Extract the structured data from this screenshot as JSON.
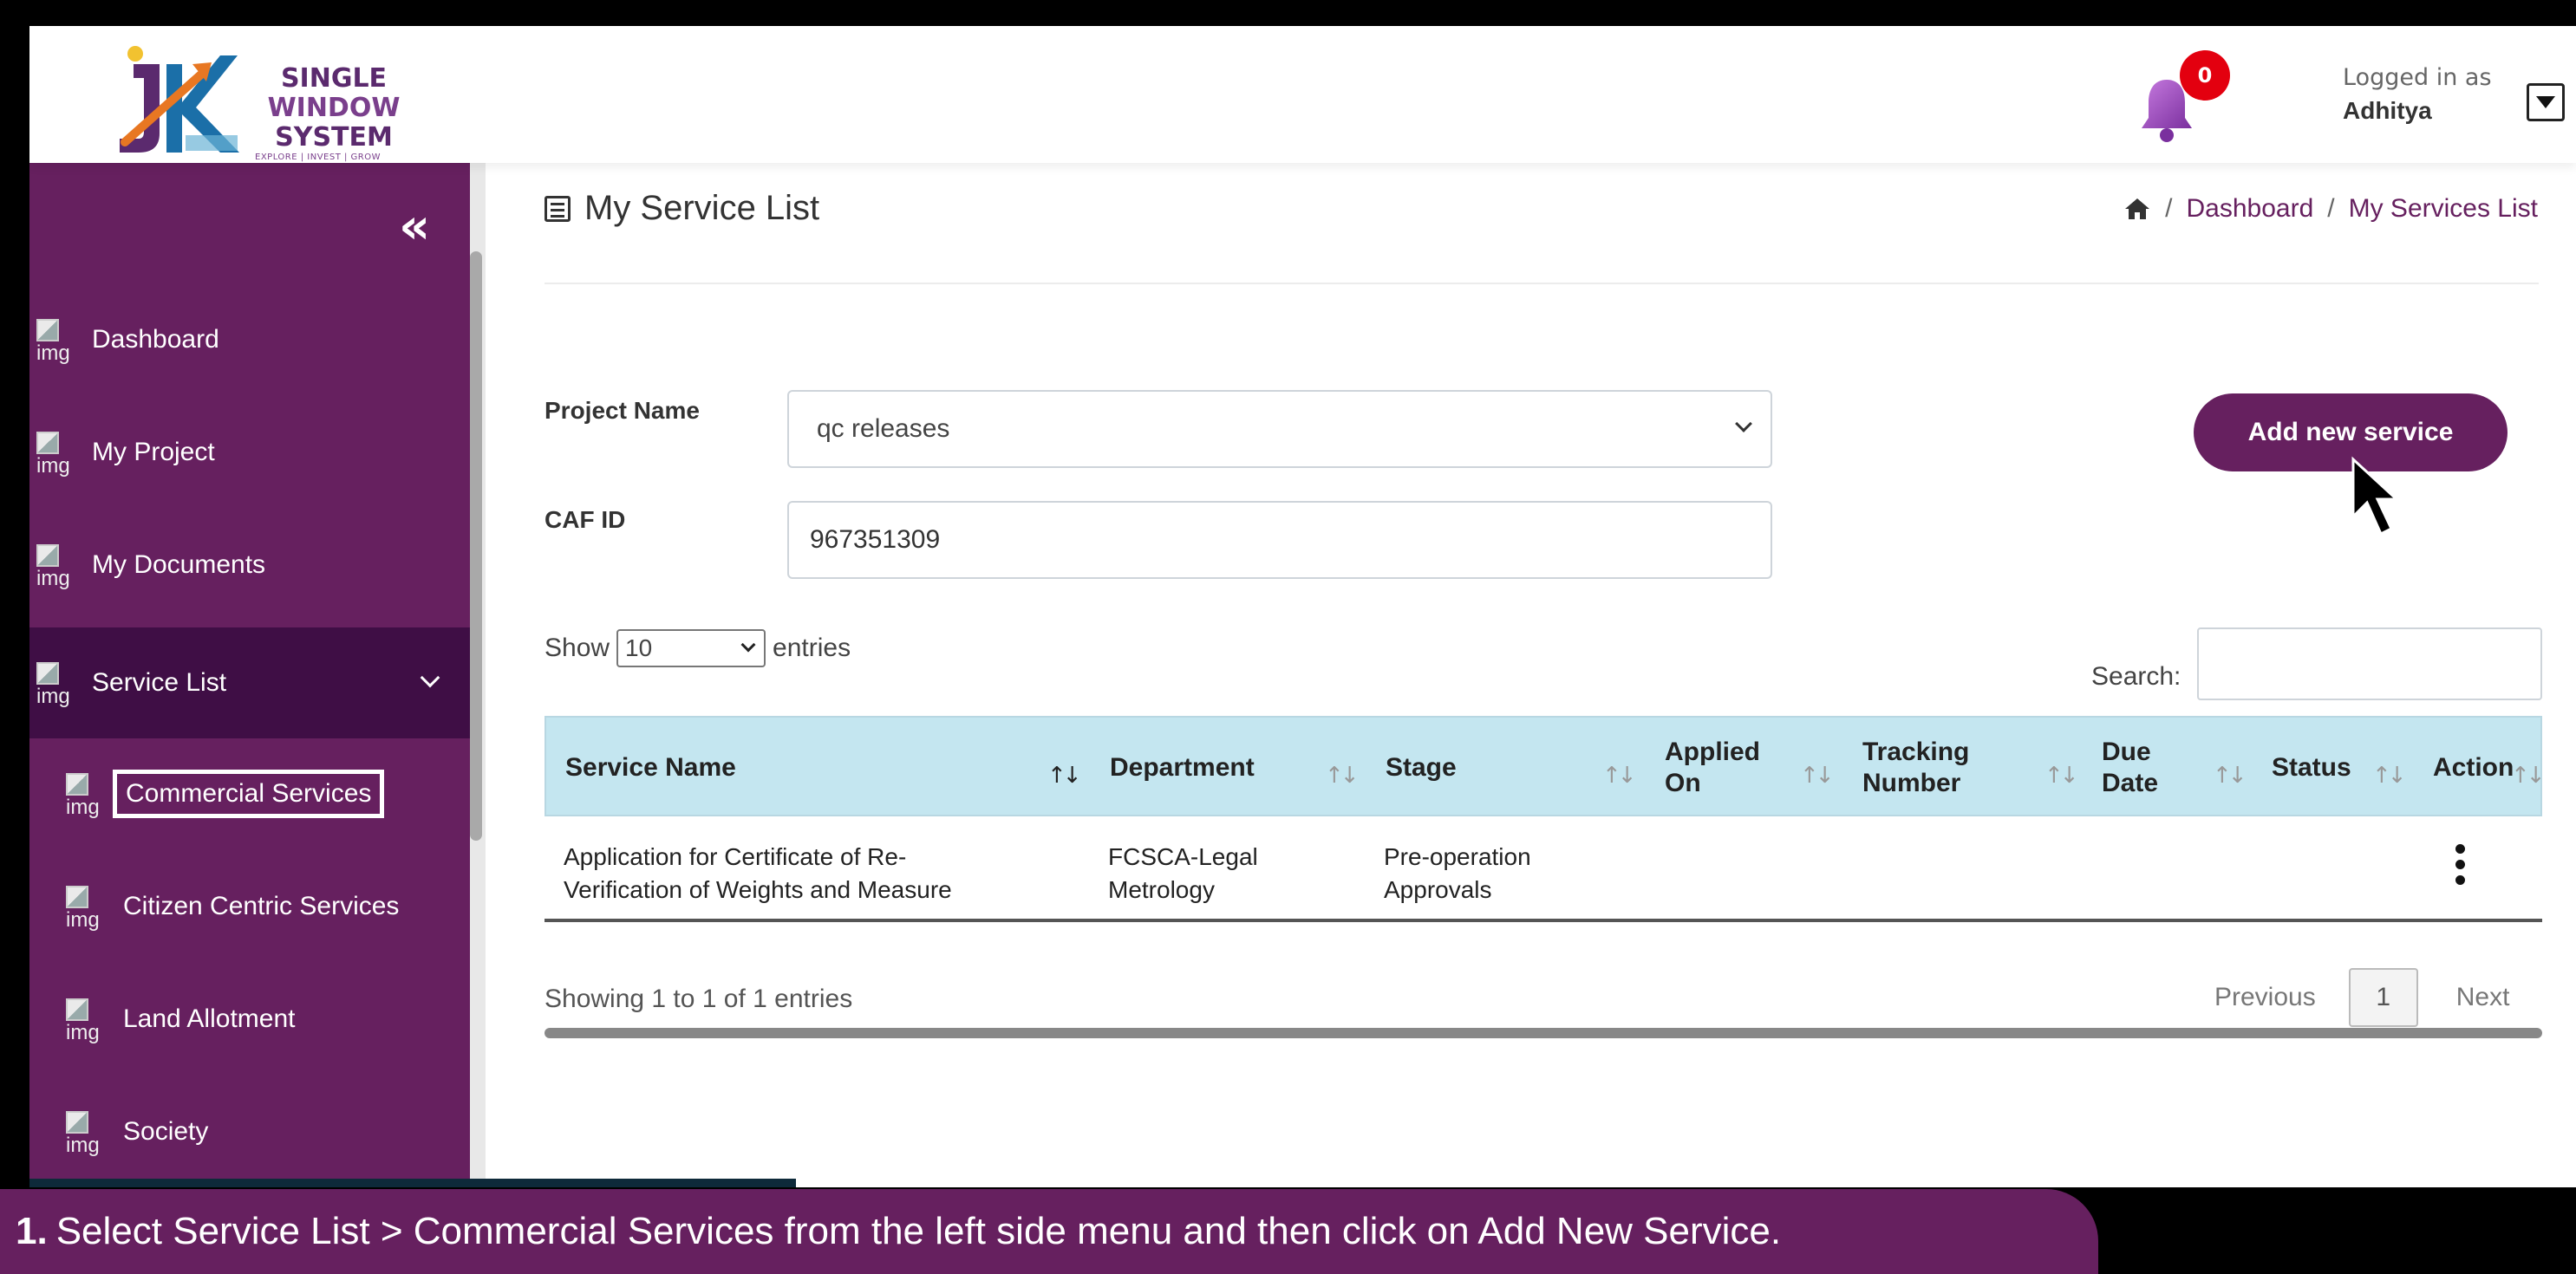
{
  "header": {
    "logo": {
      "line1": "SINGLE",
      "line2": "WINDOW",
      "line3": "SYSTEM",
      "tagline": "EXPLORE | INVEST | GROW",
      "letters": "JK"
    },
    "notification_count": "0",
    "logged_in_label": "Logged in as",
    "user_name": "Adhitya"
  },
  "sidebar": {
    "collapse_glyph": "«",
    "img_alt": "img",
    "items": [
      {
        "label": "Dashboard"
      },
      {
        "label": "My Project"
      },
      {
        "label": "My Documents"
      },
      {
        "label": "Service List"
      },
      {
        "label": "Commercial Services"
      },
      {
        "label": "Citizen Centric Services"
      },
      {
        "label": "Land Allotment"
      },
      {
        "label": "Society"
      }
    ]
  },
  "main": {
    "title": "My Service List",
    "breadcrumb": {
      "sep": "/",
      "dashboard": "Dashboard",
      "current": "My Services List"
    },
    "form": {
      "project_label": "Project Name",
      "project_value": "qc releases",
      "caf_label": "CAF ID",
      "caf_value": "967351309"
    },
    "add_button": "Add new service",
    "show": {
      "prefix": "Show",
      "value": "10",
      "suffix": "entries"
    },
    "search_label": "Search:",
    "table": {
      "headers": [
        "Service Name",
        "Department",
        "Stage",
        "Applied On",
        "Tracking Number",
        "Due Date",
        "Status",
        "Action"
      ],
      "rows": [
        {
          "service_name": "Application for Certificate of Re-Verification of Weights and Measure",
          "department": "FCSCA-Legal Metrology",
          "stage": "Pre-operation Approvals",
          "applied_on": "",
          "tracking_number": "",
          "due_date": "",
          "status": ""
        }
      ]
    },
    "showing": "Showing 1 to 1 of 1 entries",
    "pager": {
      "previous": "Previous",
      "page": "1",
      "next": "Next"
    }
  },
  "caption": {
    "step": "1.",
    "text": "Select Service List > Commercial Services from the left side menu and then click on Add New Service."
  },
  "colors": {
    "brand": "#66205f",
    "active": "#3f0e45",
    "table_header": "#c4e6f0",
    "badge": "#e3000f"
  }
}
